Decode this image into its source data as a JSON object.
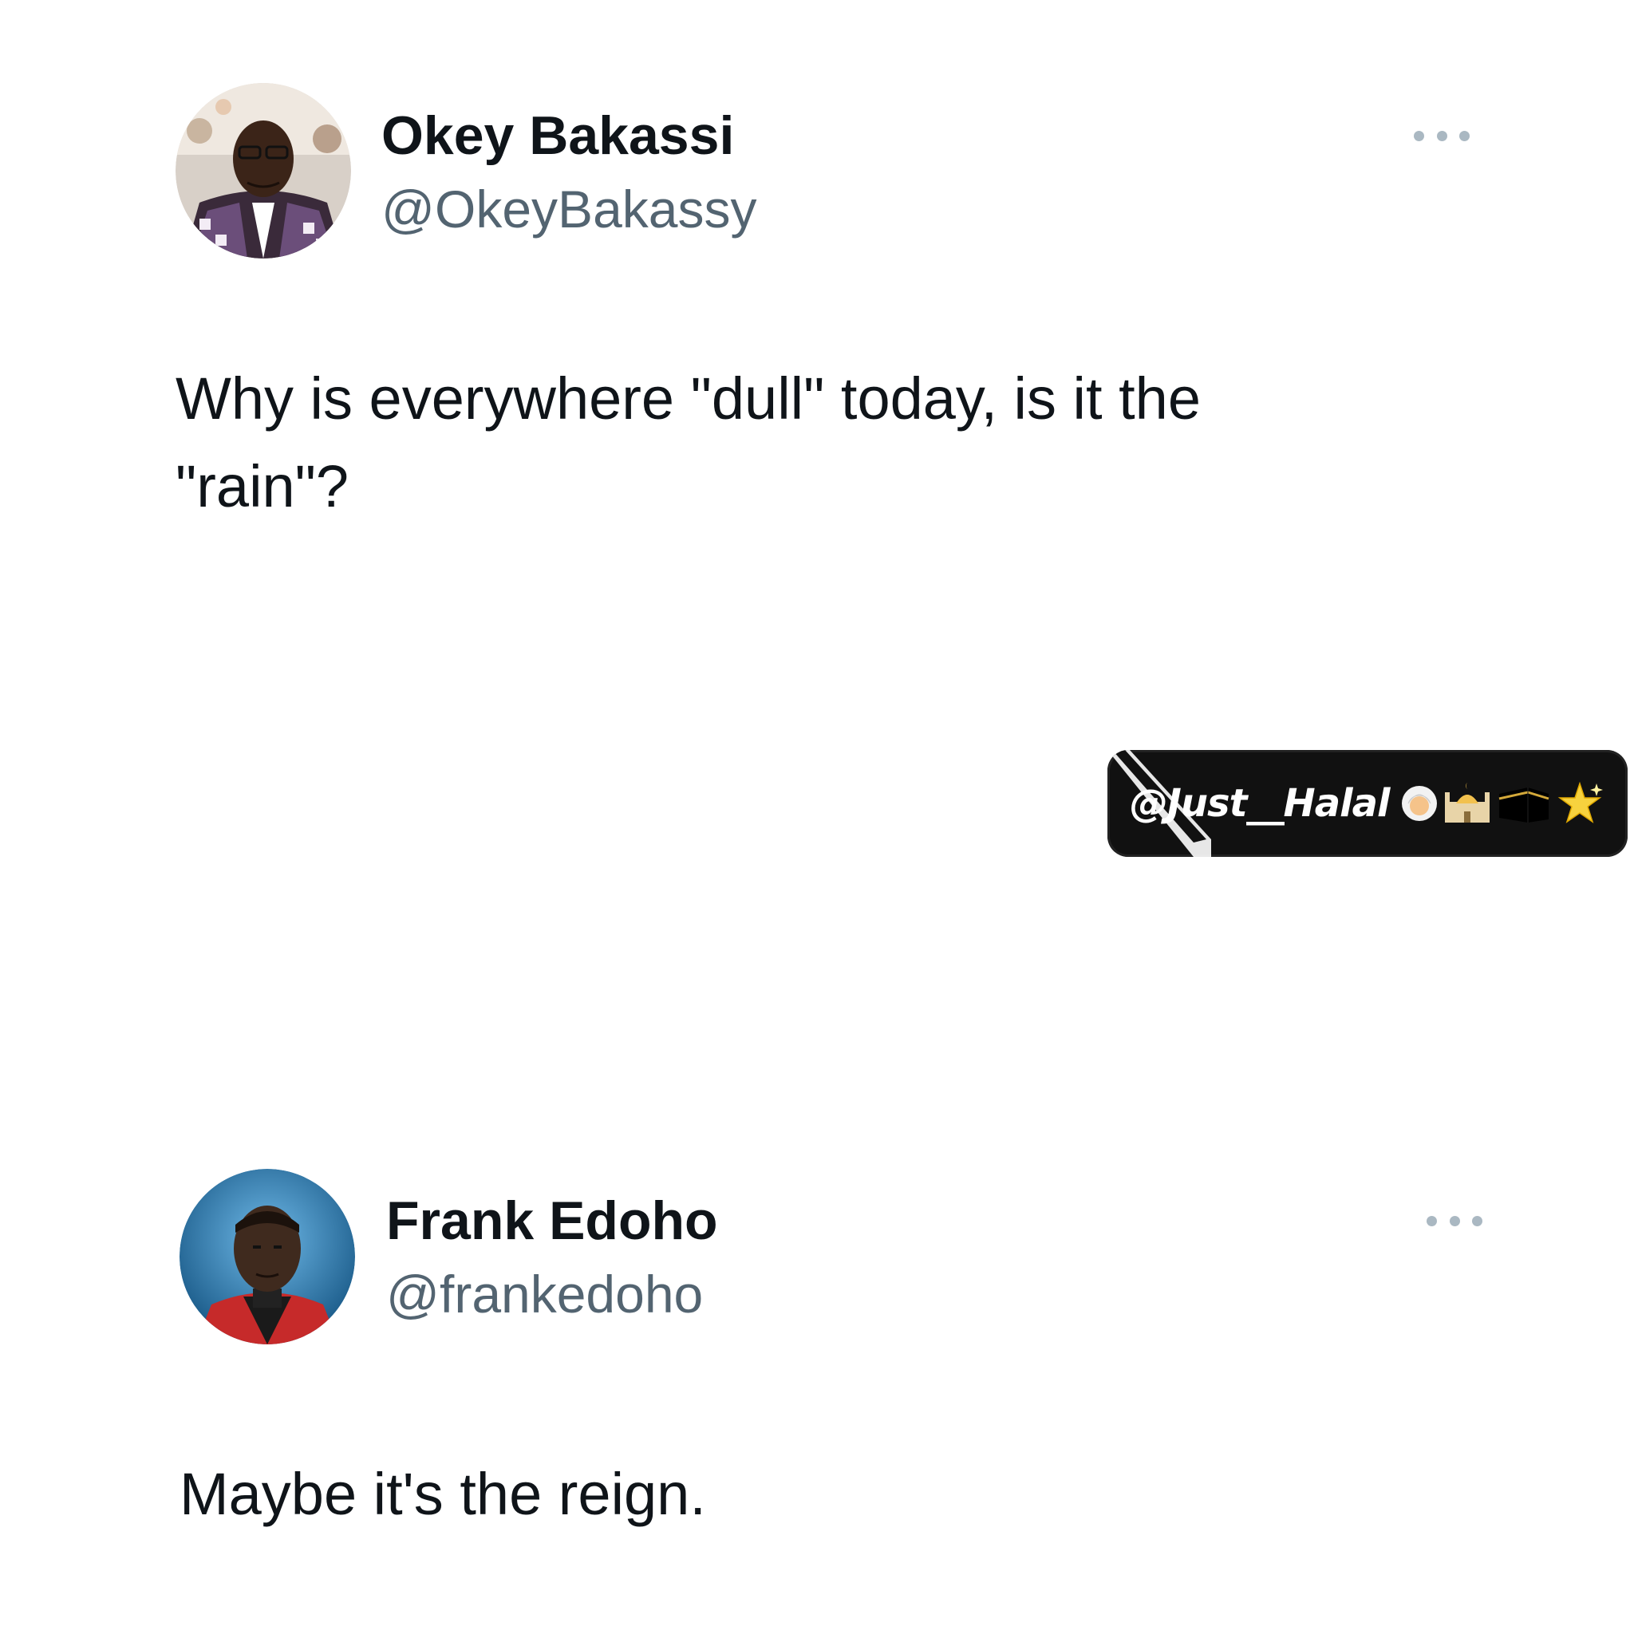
{
  "tweets": [
    {
      "name": "Okey Bakassi",
      "handle": "@OkeyBakassy",
      "text": "Why is everywhere \"dull\" today, is it the \"rain\"?",
      "avatar_icon": "user-photo-okey"
    },
    {
      "name": "Frank Edoho",
      "handle": "@frankedoho",
      "text": "Maybe it's the reign.",
      "avatar_icon": "user-photo-frank"
    }
  ],
  "watermark": {
    "text": "@Just__Halal",
    "icons": [
      "person-with-headscarf-icon",
      "mosque-icon",
      "kaaba-icon",
      "sparkle-star-icon"
    ]
  },
  "colors": {
    "text": "#0f1419",
    "secondary": "#536471",
    "more_dots": "#aab8c2"
  }
}
